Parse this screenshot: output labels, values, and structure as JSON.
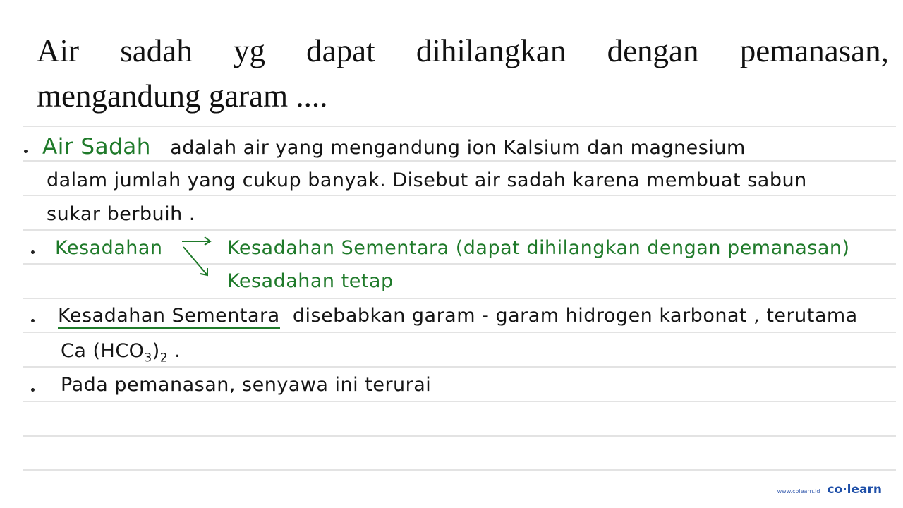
{
  "question": {
    "line1_words": [
      "Air",
      "sadah",
      "yg",
      "dapat",
      "dihilangkan",
      "dengan",
      "pemanasan,"
    ],
    "line2": "mengandung garam ...."
  },
  "notes": {
    "p1": {
      "term": "Air Sadah",
      "rest_line1": "adalah air yang mengandung ion Kalsium dan magnesium",
      "line2": "dalam jumlah yang cukup banyak. Disebut air sadah karena membuat sabun",
      "line3": "sukar berbuih ."
    },
    "p2": {
      "term": "Kesadahan",
      "branch1": "Kesadahan Sementara (dapat dihilangkan dengan pemanasan)",
      "branch2": "Kesadahan tetap"
    },
    "p3": {
      "term": "Kesadahan Sementara",
      "rest_line1": "disebabkan garam - garam hidrogen karbonat , terutama",
      "formula_prefix": "Ca (HCO",
      "formula_sub1": "3",
      "formula_mid": ")",
      "formula_sub2": "2",
      "formula_suffix": " ."
    },
    "p4": {
      "text": "Pada pemanasan, senyawa ini terurai"
    }
  },
  "brand": {
    "url": "www.colearn.id",
    "logo": "co·learn"
  },
  "colors": {
    "accent_green": "#1f7a2a",
    "brand_blue": "#1e4fa8"
  }
}
